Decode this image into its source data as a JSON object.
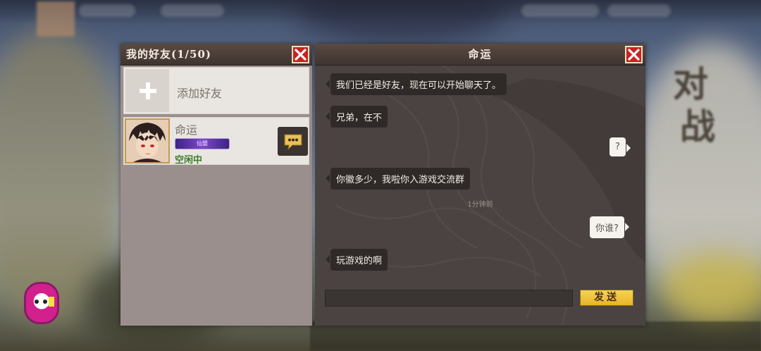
{
  "friends_panel": {
    "title": "我的好友(1/50)",
    "add_friend_label": "添加好友",
    "close_icon": "close-icon",
    "friends": [
      {
        "name": "命运",
        "badge": "仙盟",
        "status": "空闲中",
        "chat_icon": "chat-bubble-icon"
      }
    ]
  },
  "chat_panel": {
    "title": "命运",
    "close_icon": "close-icon",
    "messages": [
      {
        "side": "left",
        "text": "我们已经是好友，现在可以开始聊天了。"
      },
      {
        "side": "left",
        "text": "兄弟，在不"
      },
      {
        "side": "right",
        "text": "?"
      },
      {
        "side": "left",
        "text": "你徽多少，我啦你入游戏交流群"
      },
      {
        "side": "right",
        "text": "你谁?"
      },
      {
        "side": "left",
        "text": "玩游戏的啊"
      }
    ],
    "timestamp": "1分钟前",
    "input_value": "",
    "send_label": "发送"
  },
  "background": {
    "side_text_1": "对",
    "side_text_2": "战"
  },
  "colors": {
    "close_red": "#c8241f",
    "send_gold": "#f0c63c",
    "status_green": "#3e7d2b",
    "badge_purple": "#6b3fb8"
  }
}
